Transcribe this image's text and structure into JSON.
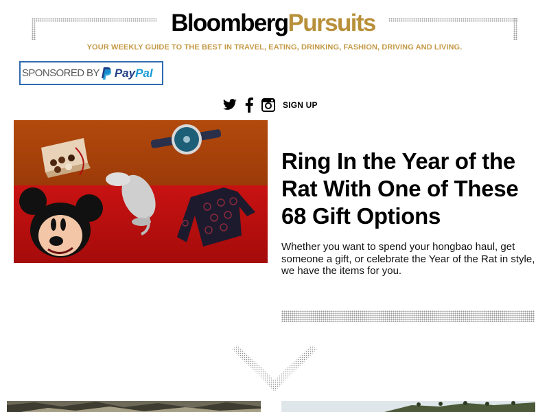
{
  "masthead": {
    "logo_part1": "Bloomberg",
    "logo_part2": "Pursuits",
    "tagline": "YOUR WEEKLY GUIDE TO THE BEST IN TRAVEL, EATING, DRINKING, FASHION, DRIVING AND LIVING."
  },
  "sponsor": {
    "label": "SPONSORED BY",
    "brand_part1": "Pay",
    "brand_part2": "Pal"
  },
  "social": {
    "icons": [
      "twitter-icon",
      "facebook-icon",
      "instagram-icon"
    ],
    "signup_label": "SIGN UP"
  },
  "feature": {
    "headline": "Ring In the Year of the Rat With One of These 68 Gift Options",
    "dek": "Whether you want to spend your hongbao haul, get someone a gift, or celebrate the Year of the Rat in style, we have the items for you."
  },
  "colors": {
    "gold": "#c49a46",
    "logo_gold": "#b8903a",
    "paypal_dark": "#223e86",
    "paypal_light": "#179bd7",
    "sponsor_border": "#2f6ab0"
  }
}
